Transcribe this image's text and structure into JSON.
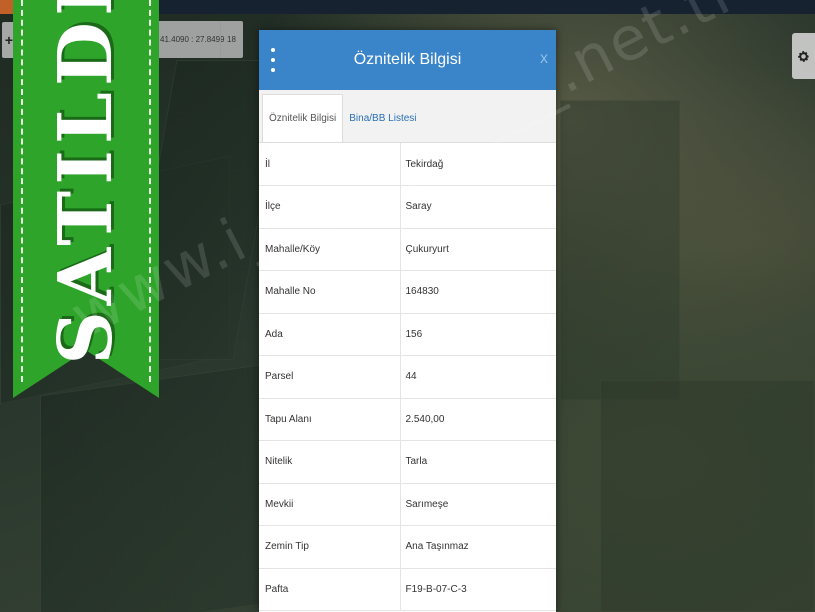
{
  "map": {
    "coords": "41.4090 : 27.8499",
    "zoom": "18",
    "watermark": "www.i___________.net.tr"
  },
  "ribbon": {
    "text": "SATILDI",
    "color": "#2ea52a"
  },
  "dialog": {
    "title": "Öznitelik Bilgisi",
    "close_label": "x",
    "header_color": "#3a84c9",
    "tabs": [
      {
        "label": "Öznitelik Bilgisi",
        "active": true
      },
      {
        "label": "Bina/BB Listesi",
        "active": false
      }
    ],
    "rows": [
      {
        "label": "İl",
        "value": "Tekirdağ"
      },
      {
        "label": "İlçe",
        "value": "Saray"
      },
      {
        "label": "Mahalle/Köy",
        "value": "Çukuryurt"
      },
      {
        "label": "Mahalle No",
        "value": "164830"
      },
      {
        "label": "Ada",
        "value": "156"
      },
      {
        "label": "Parsel",
        "value": "44"
      },
      {
        "label": "Tapu Alanı",
        "value": "2.540,00"
      },
      {
        "label": "Nitelik",
        "value": "Tarla"
      },
      {
        "label": "Mevkii",
        "value": "Sarımeşe"
      },
      {
        "label": "Zemin Tip",
        "value": "Ana Taşınmaz"
      },
      {
        "label": "Pafta",
        "value": "F19-B-07-C-3"
      }
    ]
  },
  "icons": {
    "left_tool": "plus-icon",
    "settings": "gear-icon",
    "menu": "vertical-dots-icon",
    "close": "close-icon"
  }
}
